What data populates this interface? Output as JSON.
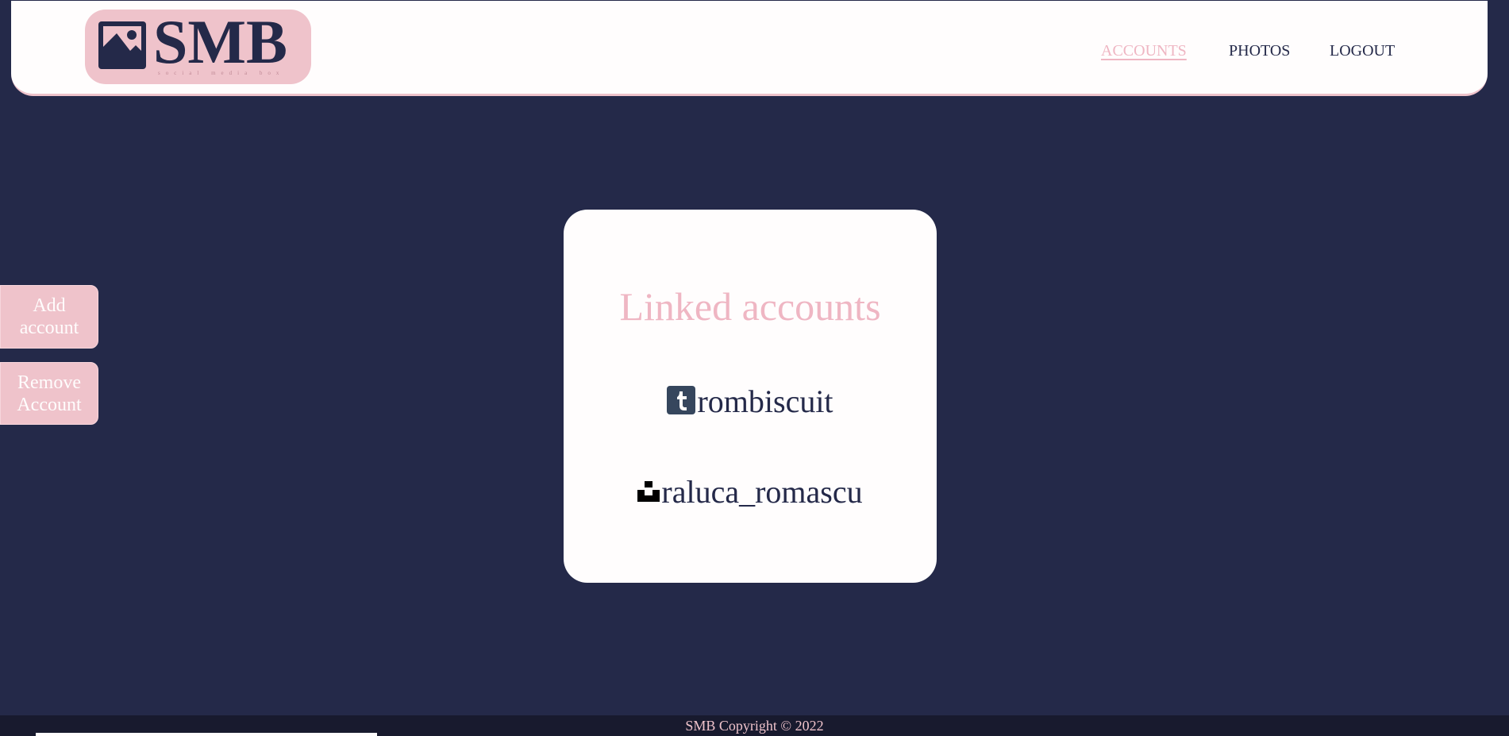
{
  "header": {
    "logo": {
      "text": "SMB",
      "tagline": "social media box",
      "icon": "image-icon"
    },
    "nav": [
      {
        "label": "ACCOUNTS",
        "active": true
      },
      {
        "label": "PHOTOS",
        "active": false
      },
      {
        "label": "LOGOUT",
        "active": false
      }
    ]
  },
  "sidebar": {
    "add_label": "Add account",
    "remove_label": "Remove Account"
  },
  "card": {
    "title": "Linked accounts",
    "accounts": [
      {
        "name": "rombiscuit",
        "icon": "tumblr-icon"
      },
      {
        "name": "raluca_romascu",
        "icon": "unsplash-icon"
      }
    ]
  },
  "footer": {
    "text": "SMB Copyright © 2022"
  },
  "colors": {
    "background": "#242949",
    "accent_pink": "#efc3cb",
    "card": "#fffdfd",
    "tumblr_blue": "#36465d"
  }
}
